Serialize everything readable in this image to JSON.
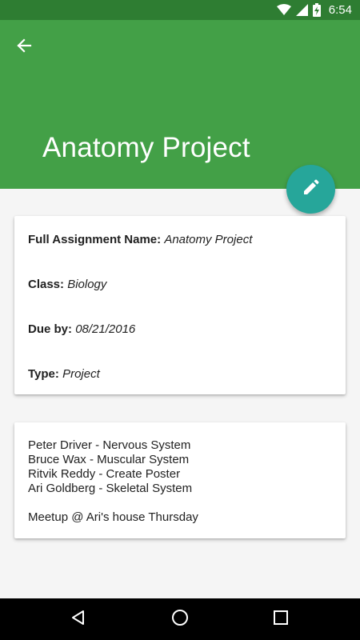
{
  "status_bar": {
    "time": "6:54",
    "icons": [
      "wifi-icon",
      "cellular-signal-icon",
      "battery-charging-icon"
    ]
  },
  "app_bar": {
    "back_icon": "arrow-back-icon",
    "title": "Anatomy Project",
    "color": "#43a047"
  },
  "fab": {
    "icon": "edit-pencil-icon",
    "color": "#26a69a"
  },
  "details": {
    "full_name_label": "Full Assignment Name:",
    "full_name_value": "Anatomy Project",
    "class_label": "Class:",
    "class_value": "Biology",
    "due_label": "Due by:",
    "due_value": "08/21/2016",
    "type_label": "Type:",
    "type_value": "Project"
  },
  "notes": {
    "lines": [
      "Peter Driver - Nervous System",
      "Bruce Wax - Muscular System",
      "Ritvik Reddy - Create Poster",
      "Ari Goldberg - Skeletal System"
    ],
    "extra_line": "Meetup @ Ari's house Thursday"
  },
  "nav_bar": {
    "icons": [
      "back-triangle-icon",
      "home-circle-icon",
      "recents-square-icon"
    ]
  }
}
